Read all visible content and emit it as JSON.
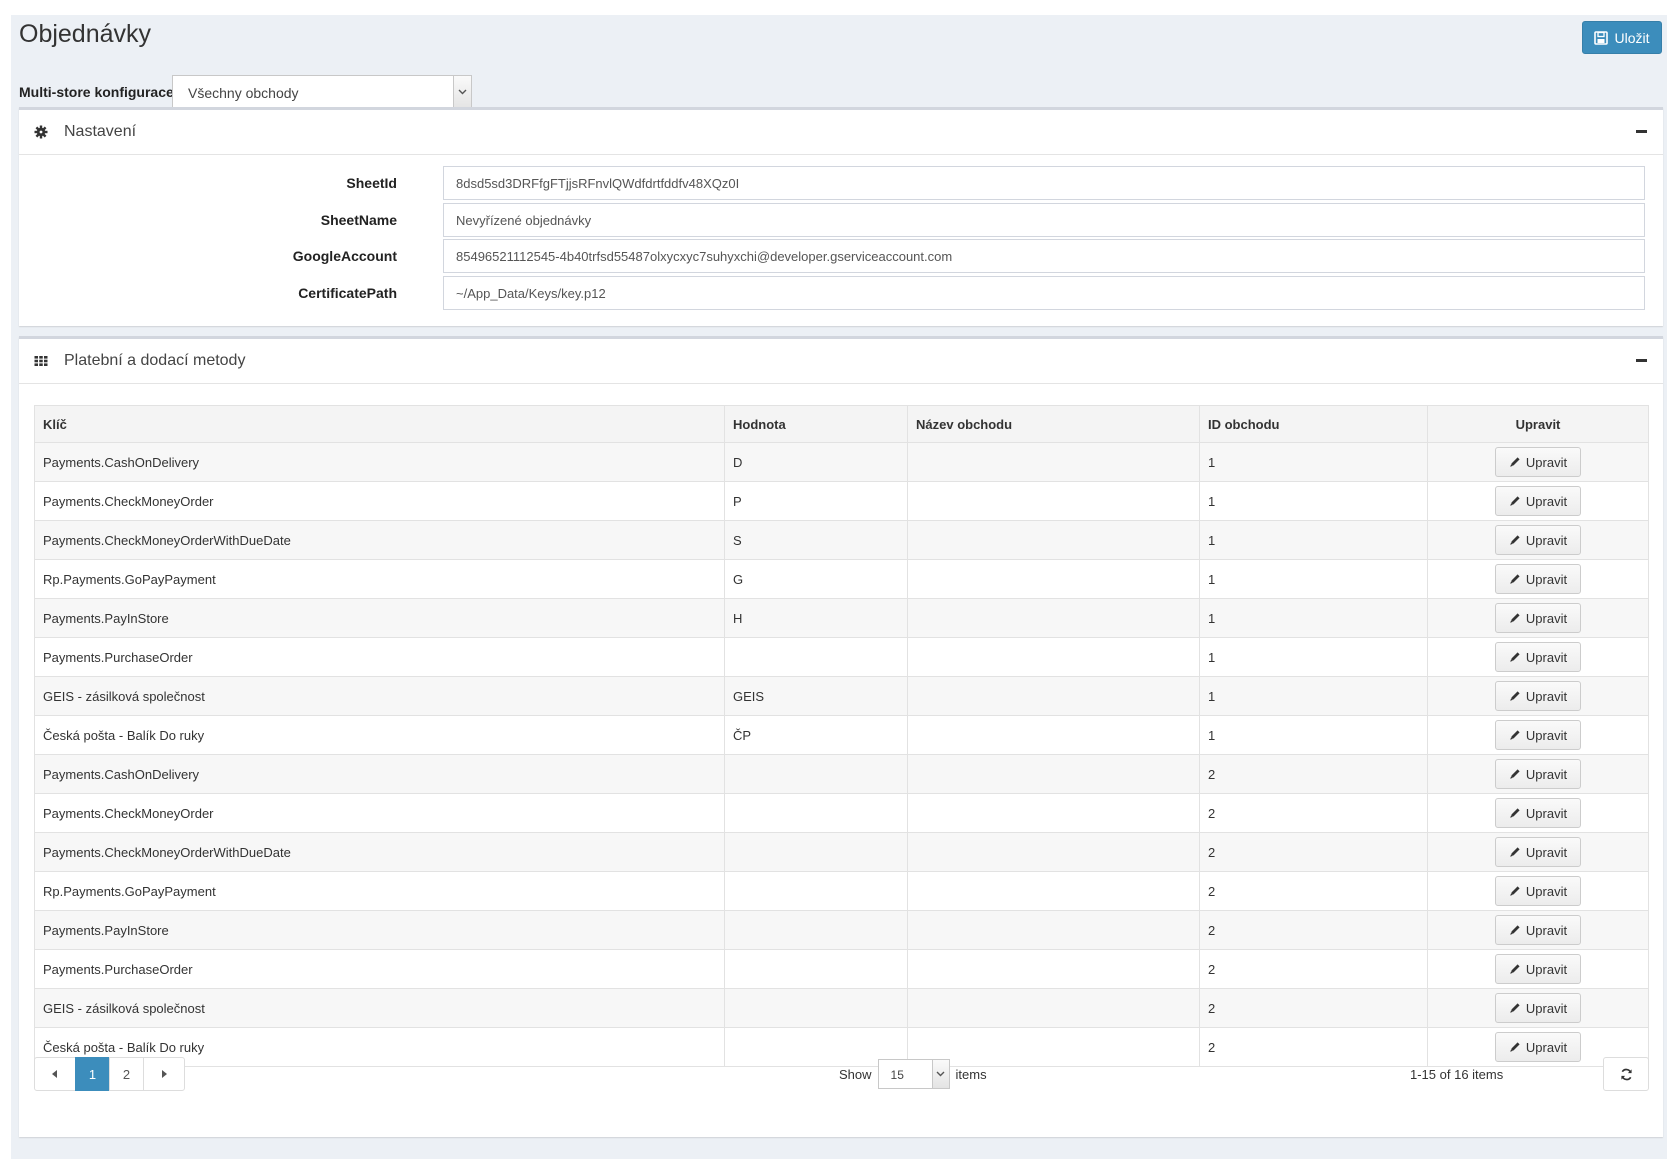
{
  "header": {
    "title": "Objednávky",
    "save_label": "Uložit"
  },
  "multistore": {
    "label": "Multi-store konfigurace",
    "selected": "Všechny obchody"
  },
  "settings_panel": {
    "title": "Nastavení",
    "fields": [
      {
        "label": "SheetId",
        "value": "8dsd5sd3DRFfgFTjjsRFnvlQWdfdrtfddfv48XQz0I"
      },
      {
        "label": "SheetName",
        "value": "Nevyřízené objednávky"
      },
      {
        "label": "GoogleAccount",
        "value": "85496521112545-4b40trfsd55487olxycxyc7suhyxchi@developer.gserviceaccount.com"
      },
      {
        "label": "CertificatePath",
        "value": "~/App_Data/Keys/key.p12"
      }
    ]
  },
  "methods_panel": {
    "title": "Platební a dodací metody",
    "columns": {
      "key": "Klíč",
      "value": "Hodnota",
      "store_name": "Název obchodu",
      "store_id": "ID obchodu",
      "edit": "Upravit"
    },
    "edit_label": "Upravit",
    "rows": [
      {
        "key": "Payments.CashOnDelivery",
        "value": "D",
        "store_name": "",
        "store_id": "1"
      },
      {
        "key": "Payments.CheckMoneyOrder",
        "value": "P",
        "store_name": "",
        "store_id": "1"
      },
      {
        "key": "Payments.CheckMoneyOrderWithDueDate",
        "value": "S",
        "store_name": "",
        "store_id": "1"
      },
      {
        "key": "Rp.Payments.GoPayPayment",
        "value": "G",
        "store_name": "",
        "store_id": "1"
      },
      {
        "key": "Payments.PayInStore",
        "value": "H",
        "store_name": "",
        "store_id": "1"
      },
      {
        "key": "Payments.PurchaseOrder",
        "value": "",
        "store_name": "",
        "store_id": "1"
      },
      {
        "key": "GEIS - zásilková společnost",
        "value": "GEIS",
        "store_name": "",
        "store_id": "1"
      },
      {
        "key": "Česká pošta - Balík Do ruky",
        "value": "ČP",
        "store_name": "",
        "store_id": "1"
      },
      {
        "key": "Payments.CashOnDelivery",
        "value": "",
        "store_name": "",
        "store_id": "2"
      },
      {
        "key": "Payments.CheckMoneyOrder",
        "value": "",
        "store_name": "",
        "store_id": "2"
      },
      {
        "key": "Payments.CheckMoneyOrderWithDueDate",
        "value": "",
        "store_name": "",
        "store_id": "2"
      },
      {
        "key": "Rp.Payments.GoPayPayment",
        "value": "",
        "store_name": "",
        "store_id": "2"
      },
      {
        "key": "Payments.PayInStore",
        "value": "",
        "store_name": "",
        "store_id": "2"
      },
      {
        "key": "Payments.PurchaseOrder",
        "value": "",
        "store_name": "",
        "store_id": "2"
      },
      {
        "key": "GEIS - zásilková společnost",
        "value": "",
        "store_name": "",
        "store_id": "2"
      },
      {
        "key": "Česká pošta - Balík Do ruky",
        "value": "",
        "store_name": "",
        "store_id": "2"
      }
    ]
  },
  "pager": {
    "pages": [
      "1",
      "2"
    ],
    "active_page": "1",
    "show_label": "Show",
    "page_size": "15",
    "items_label": "items",
    "range_text": "1-15 of 16 items"
  },
  "colors": {
    "primary": "#3c8dbc",
    "background": "#ecf0f5"
  },
  "icons": {
    "save": "floppy-disk-icon",
    "settings": "gear-icon",
    "methods": "grid-icon",
    "edit": "pencil-icon",
    "refresh": "refresh-icon"
  }
}
